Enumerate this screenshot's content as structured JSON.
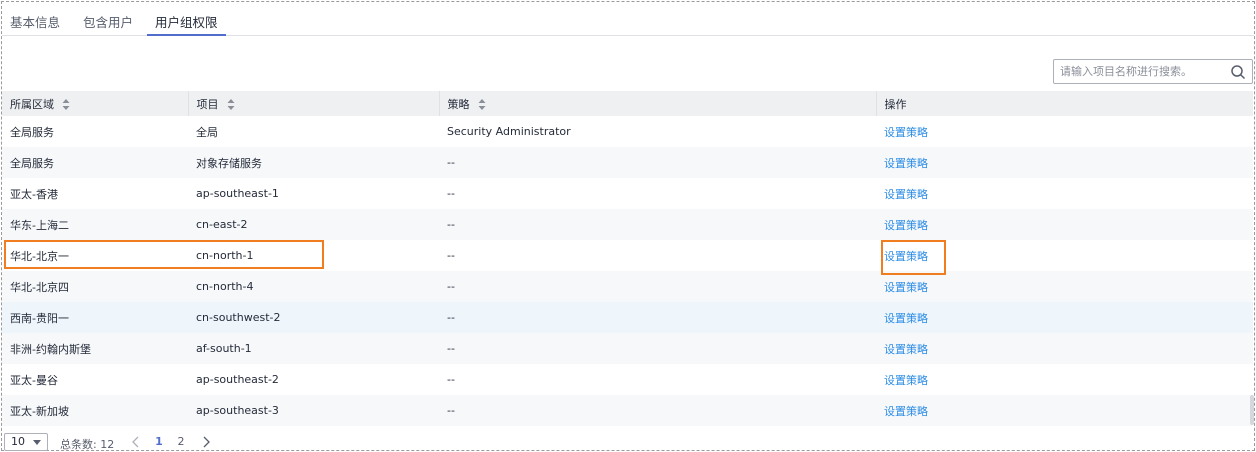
{
  "tabs": [
    {
      "label": "基本信息",
      "active": false
    },
    {
      "label": "包含用户",
      "active": false
    },
    {
      "label": "用户组权限",
      "active": true
    }
  ],
  "search": {
    "placeholder": "请输入项目名称进行搜索。",
    "icon": "search-icon"
  },
  "table": {
    "headers": [
      "所属区域",
      "项目",
      "策略",
      "操作"
    ],
    "rows": [
      {
        "region": "全局服务",
        "project": "全局",
        "policy": "Security Administrator",
        "action": "设置策略"
      },
      {
        "region": "全局服务",
        "project": "对象存储服务",
        "policy": "--",
        "action": "设置策略"
      },
      {
        "region": "亚太-香港",
        "project": "ap-southeast-1",
        "policy": "--",
        "action": "设置策略"
      },
      {
        "region": "华东-上海二",
        "project": "cn-east-2",
        "policy": "--",
        "action": "设置策略"
      },
      {
        "region": "华北-北京一",
        "project": "cn-north-1",
        "policy": "--",
        "action": "设置策略"
      },
      {
        "region": "华北-北京四",
        "project": "cn-north-4",
        "policy": "--",
        "action": "设置策略"
      },
      {
        "region": "西南-贵阳一",
        "project": "cn-southwest-2",
        "policy": "--",
        "action": "设置策略"
      },
      {
        "region": "非洲-约翰内斯堡",
        "project": "af-south-1",
        "policy": "--",
        "action": "设置策略"
      },
      {
        "region": "亚太-曼谷",
        "project": "ap-southeast-2",
        "policy": "--",
        "action": "设置策略"
      },
      {
        "region": "亚太-新加坡",
        "project": "ap-southeast-3",
        "policy": "--",
        "action": "设置策略"
      }
    ]
  },
  "pagination": {
    "page_size": "10",
    "total": "总条数: 12",
    "pages": [
      "1",
      "2"
    ],
    "current": "1"
  },
  "colors": {
    "accent": "#526ecc",
    "link": "#2b8ce6",
    "highlight": "#f07d1f",
    "header_bg": "#eff0f2"
  }
}
